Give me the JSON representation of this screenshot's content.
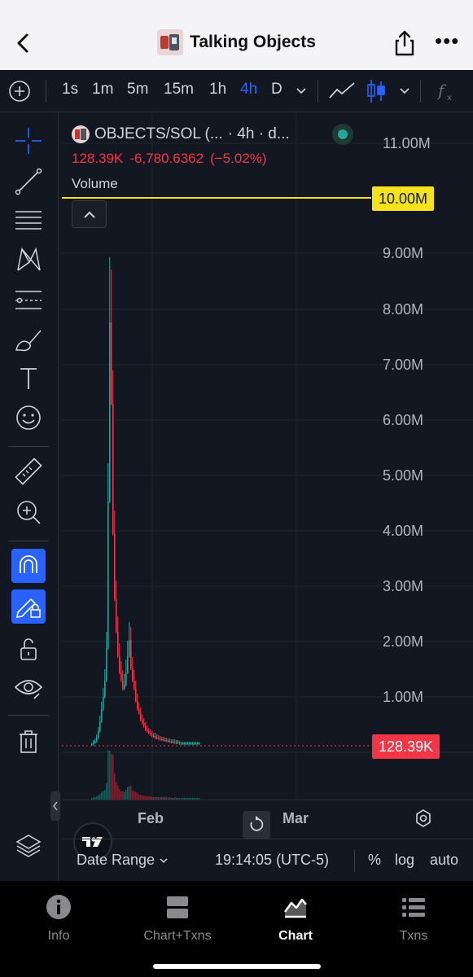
{
  "header": {
    "title": "Talking Objects",
    "back_icon": "chevron-left-icon",
    "share_icon": "share-icon",
    "more_label": "•••"
  },
  "toolbar": {
    "timeframes": [
      "1s",
      "1m",
      "5m",
      "15m",
      "1h",
      "4h",
      "D"
    ],
    "active_timeframe": "4h",
    "active_color": "#2962ff"
  },
  "legend": {
    "symbol": "OBJECTS/SOL (...",
    "interval": "· 4h · d...",
    "last": "128.39K",
    "change": "-6,780.6362",
    "change_pct": "(−5.02%)",
    "volume_label": "Volume",
    "down_color": "#f23645",
    "up_color": "#26a69a"
  },
  "price_axis": {
    "ticks": [
      "11.00M",
      "9.00M",
      "8.00M",
      "7.00M",
      "6.00M",
      "5.00M",
      "4.00M",
      "3.00M",
      "2.00M",
      "1.00M"
    ],
    "hline_label": "10.00M",
    "hline_color": "#f5e21b",
    "current_price_label": "128.39K",
    "current_price_color": "#f23645"
  },
  "time_axis": {
    "ticks": [
      "Feb",
      "Mar"
    ]
  },
  "bottom_bar": {
    "date_range": "Date Range",
    "time": "19:14:05 (UTC-5)",
    "percent": "%",
    "log": "log",
    "auto": "auto"
  },
  "tabs": [
    {
      "label": "Info",
      "icon": "info-icon",
      "active": false
    },
    {
      "label": "Chart+Txns",
      "icon": "split-view-icon",
      "active": false
    },
    {
      "label": "Chart",
      "icon": "chart-icon",
      "active": true
    },
    {
      "label": "Txns",
      "icon": "list-icon",
      "active": false
    }
  ]
}
